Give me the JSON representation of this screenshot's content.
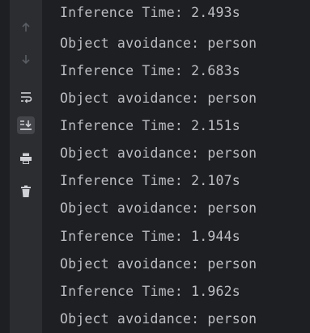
{
  "console": {
    "lines": [
      "Inference Time: 2.493s",
      "Object avoidance: person",
      "Inference Time: 2.683s",
      "Object avoidance: person",
      "Inference Time: 2.151s",
      "Object avoidance: person",
      "Inference Time: 2.107s",
      "Object avoidance: person",
      "Inference Time: 1.944s",
      "Object avoidance: person",
      "Inference Time: 1.962s",
      "Object avoidance: person"
    ]
  },
  "toolbar": {
    "icons": [
      "up-arrow-icon",
      "down-arrow-icon",
      "soft-wrap-icon",
      "scroll-to-end-icon",
      "print-icon",
      "trash-icon"
    ]
  },
  "colors": {
    "background": "#1e1f22",
    "gutter": "#2b2d30",
    "text": "#bcbec4",
    "icon": "#ced0d6",
    "icon_disabled": "#5a5d63"
  }
}
